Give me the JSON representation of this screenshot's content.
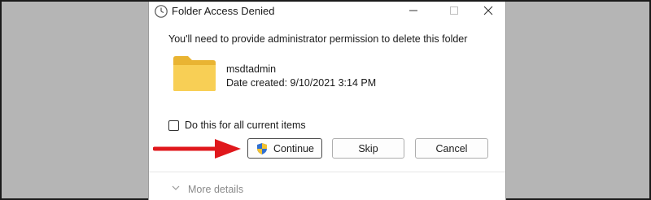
{
  "window": {
    "title": "Folder Access Denied",
    "icon": "clock-icon"
  },
  "message": "You'll need to provide administrator permission to delete this folder",
  "item": {
    "name": "msdtadmin",
    "date_created": "Date created: 9/10/2021 3:14 PM",
    "icon": "folder-icon"
  },
  "checkbox": {
    "label": "Do this for all current items",
    "checked": false
  },
  "buttons": {
    "continue": "Continue",
    "skip": "Skip",
    "cancel": "Cancel"
  },
  "footer": {
    "more_details": "More details"
  },
  "colors": {
    "annotation_arrow": "#e0181c",
    "folder": "#f6c94b",
    "backdrop": "#b5b5b5"
  }
}
